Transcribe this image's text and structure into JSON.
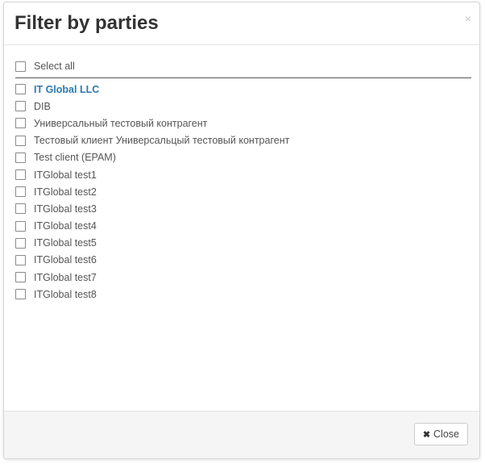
{
  "dialog": {
    "title": "Filter by parties",
    "close_symbol": "×"
  },
  "select_all_label": "Select all",
  "parties": [
    {
      "label": "IT Global LLC",
      "active": true
    },
    {
      "label": "DIB",
      "active": false
    },
    {
      "label": "Универсальный тестовый контрагент",
      "active": false
    },
    {
      "label": "Тестовый клиент Универсальцый тестовый контрагент",
      "active": false
    },
    {
      "label": "Test client (EPAM)",
      "active": false
    },
    {
      "label": "ITGlobal test1",
      "active": false
    },
    {
      "label": "ITGlobal test2",
      "active": false
    },
    {
      "label": "ITGlobal test3",
      "active": false
    },
    {
      "label": "ITGlobal test4",
      "active": false
    },
    {
      "label": "ITGlobal test5",
      "active": false
    },
    {
      "label": "ITGlobal test6",
      "active": false
    },
    {
      "label": "ITGlobal test7",
      "active": false
    },
    {
      "label": "ITGlobal test8",
      "active": false
    }
  ],
  "footer": {
    "close_label": "Close",
    "close_icon": "times-icon"
  },
  "colors": {
    "active_party": "#2a7ab0",
    "text": "#555555",
    "footer_bg": "#f5f5f5"
  }
}
